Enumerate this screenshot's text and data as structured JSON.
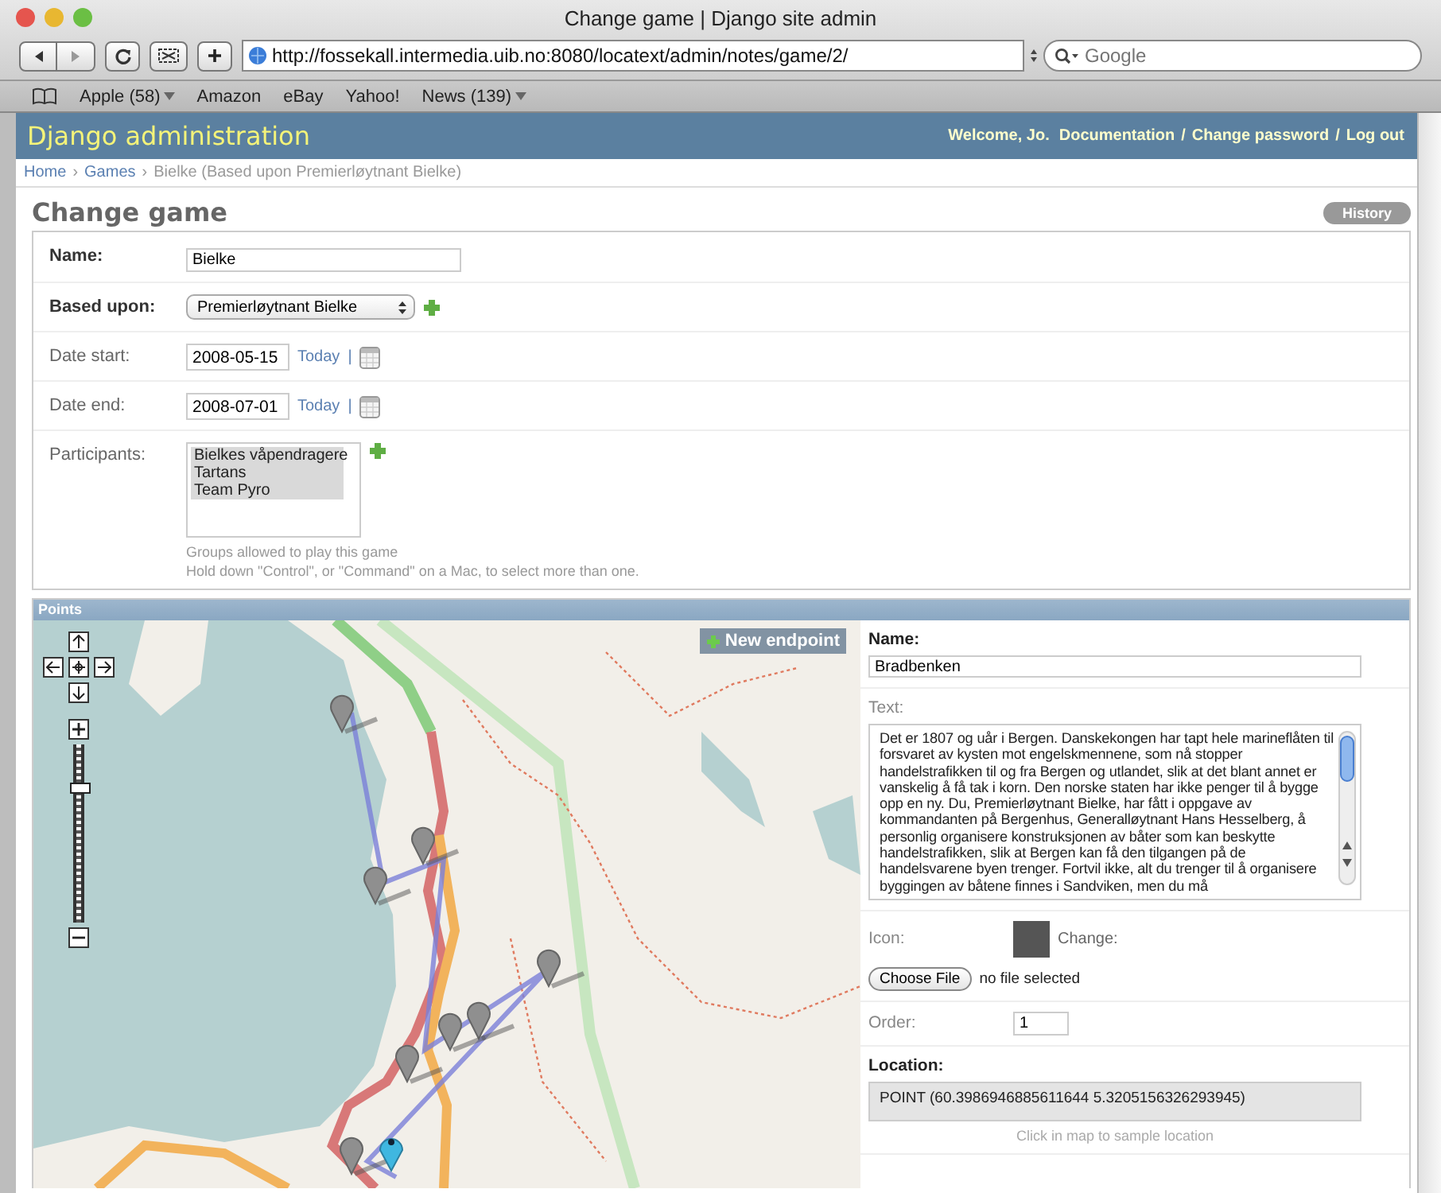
{
  "window": {
    "title": "Change game | Django site admin"
  },
  "toolbar": {
    "url": "http://fossekall.intermedia.uib.no:8080/locatext/admin/notes/game/2/",
    "search": {
      "placeholder": "Google"
    }
  },
  "bookmarks": [
    {
      "label": "Apple (58)",
      "has_menu": true
    },
    {
      "label": "Amazon",
      "has_menu": false
    },
    {
      "label": "eBay",
      "has_menu": false
    },
    {
      "label": "Yahoo!",
      "has_menu": false
    },
    {
      "label": "News (139)",
      "has_menu": true
    }
  ],
  "header": {
    "site_title": "Django administration",
    "user_tools": [
      {
        "kind": "greeting",
        "text": "Welcome, Jo."
      },
      {
        "kind": "link",
        "text": "Documentation"
      },
      {
        "kind": "separator",
        "text": "/"
      },
      {
        "kind": "link",
        "text": "Change password"
      },
      {
        "kind": "separator",
        "text": "/"
      },
      {
        "kind": "link",
        "text": "Log out"
      }
    ]
  },
  "breadcrumbs": [
    {
      "kind": "link",
      "text": "Home"
    },
    {
      "kind": "separator",
      "text": "›"
    },
    {
      "kind": "link",
      "text": "Games"
    },
    {
      "kind": "separator",
      "text": "›"
    },
    {
      "kind": "current",
      "text": "Bielke (Based upon Premierløytnant Bielke)"
    }
  ],
  "page": {
    "title": "Change game",
    "history_button": "History"
  },
  "game_fields": [
    {
      "kind": "text",
      "label": "Name:",
      "required": true,
      "value": "Bielke"
    },
    {
      "kind": "select",
      "label": "Based upon:",
      "required": true,
      "value": "Premierløytnant Bielke"
    },
    {
      "kind": "date",
      "label": "Date start:",
      "required": false,
      "value": "2008-05-15",
      "today_link": "Today",
      "separator": "|"
    },
    {
      "kind": "date",
      "label": "Date end:",
      "required": false,
      "value": "2008-07-01",
      "today_link": "Today",
      "separator": "|"
    },
    {
      "kind": "multiselect",
      "label": "Participants:",
      "required": false,
      "options": [
        {
          "text": "Bielkes våpendragere",
          "selected": true
        },
        {
          "text": "Tartans",
          "selected": true
        },
        {
          "text": "Team Pyro",
          "selected": true
        }
      ],
      "help": [
        "Groups allowed to play this game",
        "Hold down \"Control\", or \"Command\" on a Mac, to select more than one."
      ]
    }
  ],
  "points": {
    "title": "Points",
    "map": {
      "new_endpoint_button": "New endpoint",
      "zoom": {
        "level": 0.75
      }
    },
    "fields": [
      {
        "kind": "text",
        "label": "Name:",
        "required": true,
        "value": "Bradbenken"
      },
      {
        "kind": "textarea",
        "label": "Text:",
        "required": false,
        "value": "Det er 1807 og uår i Bergen. Danskekongen har tapt hele marineflåten til forsvaret av kysten mot engelskmennene, som nå stopper handelstrafikken til og fra Bergen og utlandet, slik at det blant annet er vanskelig å få tak i korn. Den norske staten har ikke penger til å bygge opp en ny. Du, Premierløytnant Bielke, har fått i oppgave av kommandanten på Bergenhus, Generalløytnant Hans Hesselberg, å personlig organisere konstruksjonen av båter som kan beskytte handelstrafikken, slik at Bergen kan få den tilgangen på de handelsvarene byen trenger. Fortvil ikke, alt du trenger til å organisere byggingen av båtene finnes i Sandviken, men du må"
      },
      {
        "kind": "image",
        "label": "Icon:",
        "required": false,
        "change_label": "Change:",
        "button": "Choose File",
        "status": "no file selected"
      },
      {
        "kind": "number",
        "label": "Order:",
        "required": false,
        "value": "1"
      },
      {
        "kind": "geometry",
        "label": "Location:",
        "required": true,
        "value": "POINT (60.3986946885611644 5.3205156326293945)",
        "help": "Click in map to sample location"
      }
    ]
  }
}
